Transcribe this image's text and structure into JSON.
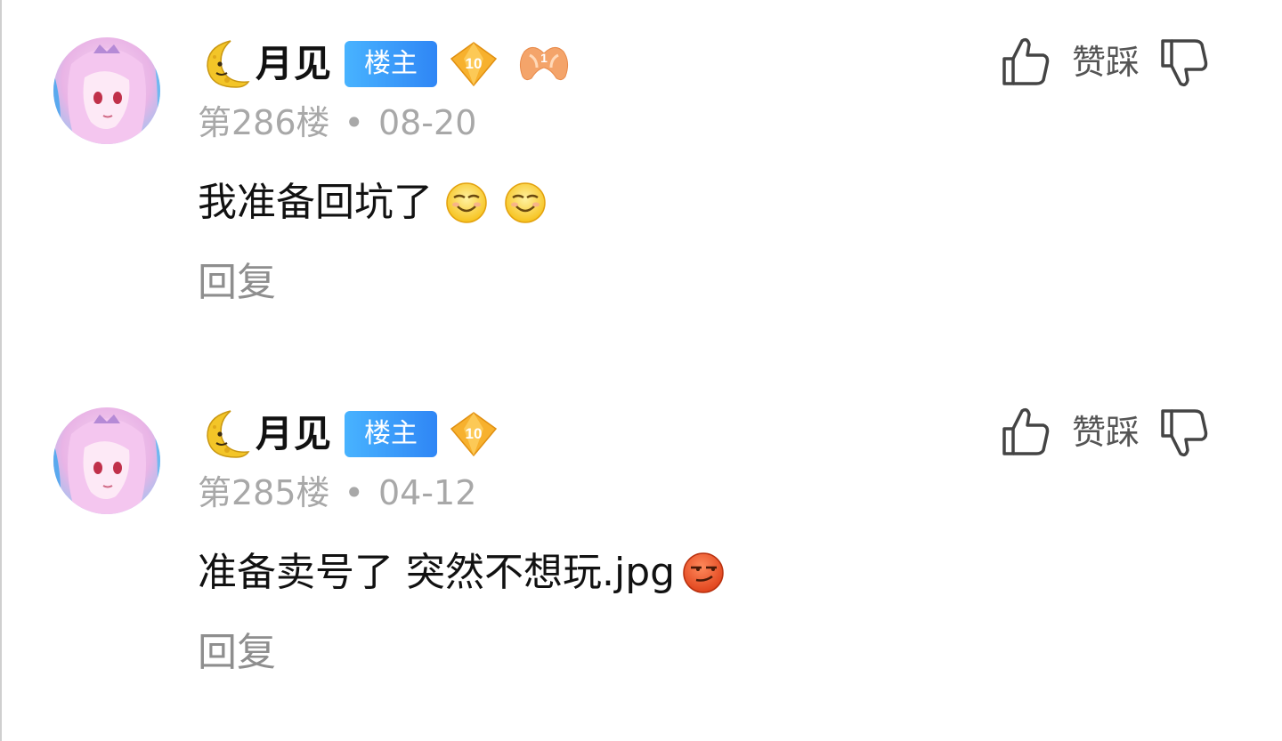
{
  "comments": [
    {
      "username": "月见",
      "op_badge": "楼主",
      "level": "10",
      "bonus_badge": "1",
      "floor": "第286楼",
      "separator": "•",
      "date": "08-20",
      "text": "我准备回坑了",
      "emojis": [
        "grin-emoji",
        "grin-emoji"
      ],
      "reply_label": "回复",
      "like_dislike_label": "赞踩"
    },
    {
      "username": "月见",
      "op_badge": "楼主",
      "level": "10",
      "floor": "第285楼",
      "separator": "•",
      "date": "04-12",
      "text": "准备卖号了 突然不想玩.jpg",
      "emojis": [
        "smirk-emoji"
      ],
      "reply_label": "回复",
      "like_dislike_label": "赞踩"
    }
  ],
  "colors": {
    "op_badge_start": "#48b3ff",
    "op_badge_end": "#2f86f5",
    "meta_text": "#a8a8a8",
    "reply_text": "#8e8e8e",
    "level_badge": "#f5a623"
  }
}
